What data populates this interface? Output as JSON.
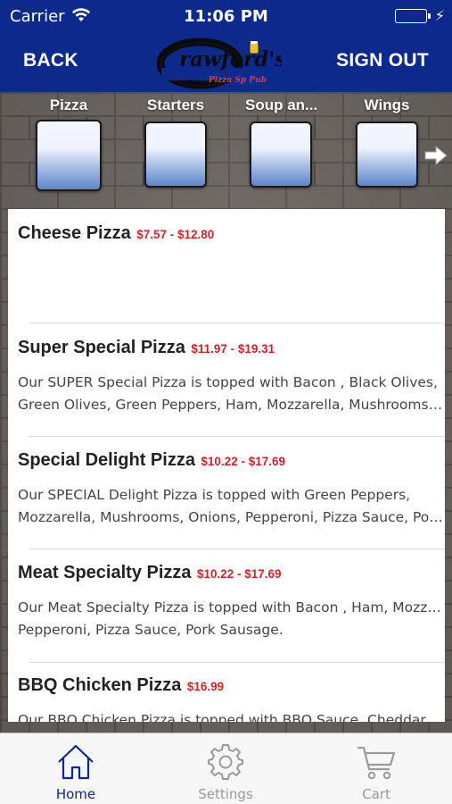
{
  "status_bar": {
    "carrier": "Carrier",
    "time": "11:06 PM"
  },
  "header": {
    "back_label": "BACK",
    "signout_label": "SIGN OUT",
    "logo_text": "Crawford's",
    "logo_subtext": "Pizza Sp Pub",
    "brand_color": "#0b2a8c"
  },
  "categories": [
    {
      "label": "Pizza"
    },
    {
      "label": "Starters"
    },
    {
      "label": "Soup an..."
    },
    {
      "label": "Wings"
    }
  ],
  "menu_items": [
    {
      "name": "Cheese Pizza",
      "price": "$7.57 - $12.80",
      "desc": []
    },
    {
      "name": "Super Special Pizza",
      "price": "$11.97 - $19.31",
      "desc": [
        "Our SUPER Special Pizza is topped with Bacon , Black Olives,",
        "Green Olives, Green Peppers, Ham, Mozzarella, Mushrooms,..."
      ]
    },
    {
      "name": "Special Delight Pizza",
      "price": "$10.22 - $17.69",
      "desc": [
        "Our SPECIAL Delight Pizza is topped with Green Peppers,",
        "Mozzarella, Mushrooms, Onions, Pepperoni, Pizza Sauce, Por..."
      ]
    },
    {
      "name": "Meat Specialty Pizza",
      "price": "$10.22 - $17.69",
      "desc": [
        "Our Meat Specialty Pizza is topped with Bacon , Ham, Mozzarella,",
        "Pepperoni, Pizza Sauce, Pork Sausage."
      ]
    },
    {
      "name": "BBQ Chicken Pizza",
      "price": "$16.99",
      "desc": [
        "Our BBQ Chicken Pizza is topped with BBQ Sauce, Cheddar..."
      ]
    }
  ],
  "tabs": [
    {
      "label": "Home",
      "icon": "home-icon"
    },
    {
      "label": "Settings",
      "icon": "gear-icon"
    },
    {
      "label": "Cart",
      "icon": "cart-icon"
    }
  ],
  "colors": {
    "price": "#d0242b",
    "active_tab": "#0b2a8c",
    "inactive_tab": "#9a9a9a"
  }
}
